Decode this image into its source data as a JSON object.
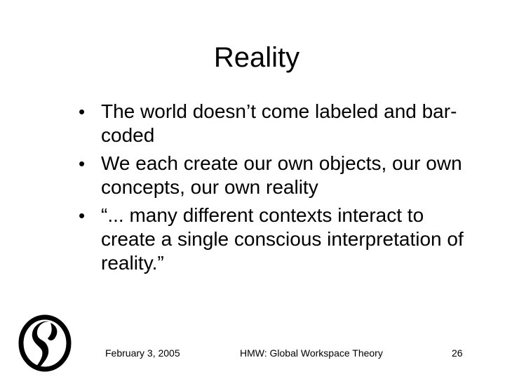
{
  "slide": {
    "title": "Reality",
    "bullets": [
      {
        "text": "The world doesn’t come labeled and bar-coded"
      },
      {
        "text": "We each create our own objects, our own concepts, our own reality"
      },
      {
        "text": "“... many different contexts interact to create a single conscious interpretation of reality.”"
      }
    ],
    "bullet_symbol": "•"
  },
  "footer": {
    "date": "February 3, 2005",
    "title": "HMW: Global Workspace Theory",
    "page": "26"
  },
  "logo": {
    "icon": "swirl-logo-icon",
    "color": "#000000"
  }
}
